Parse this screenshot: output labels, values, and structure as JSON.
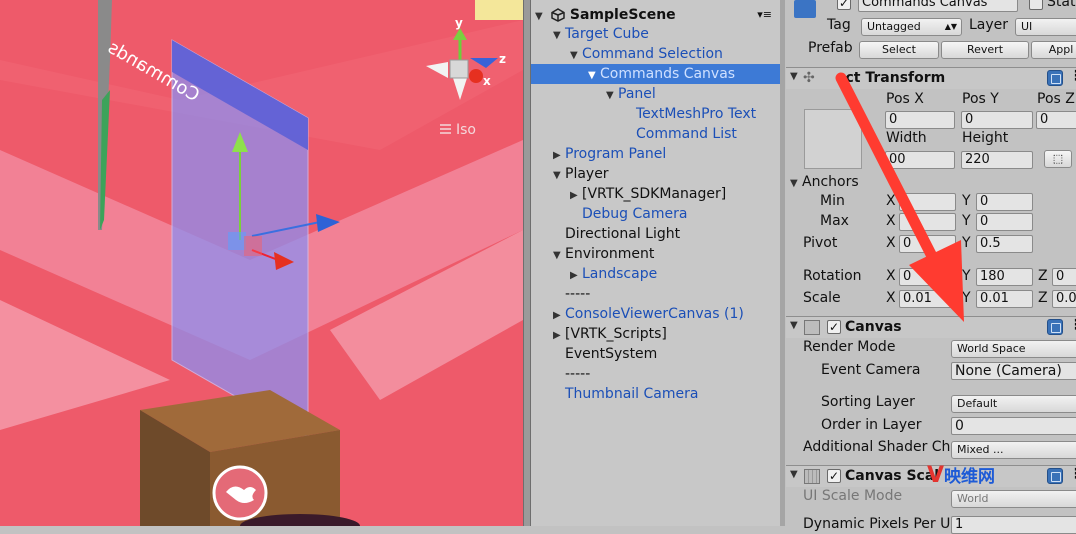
{
  "scene_view": {
    "canvas_text": "Commands",
    "gizmo_axes": {
      "x": "x",
      "y": "y",
      "z": "z"
    },
    "projection_label": "Iso"
  },
  "hierarchy": {
    "scene_name": "SampleScene",
    "items": [
      {
        "label": "Target Cube",
        "expanded": true,
        "selected": false
      },
      {
        "label": "Command Selection",
        "expanded": true,
        "selected": false
      },
      {
        "label": "Commands Canvas",
        "expanded": true,
        "selected": true
      },
      {
        "label": "Panel",
        "expanded": true,
        "selected": false
      },
      {
        "label": "TextMeshPro Text",
        "selected": false
      },
      {
        "label": "Command List",
        "selected": false
      },
      {
        "label": "Program Panel",
        "expanded": false,
        "selected": false
      },
      {
        "label": "Player",
        "expanded": true,
        "selected": false
      },
      {
        "label": "[VRTK_SDKManager]",
        "expanded": false,
        "selected": false
      },
      {
        "label": "Debug Camera",
        "selected": false
      },
      {
        "label": "Directional Light",
        "selected": false
      },
      {
        "label": "Environment",
        "expanded": true,
        "selected": false
      },
      {
        "label": "Landscape",
        "expanded": false,
        "selected": false
      },
      {
        "label": "-----",
        "selected": false
      },
      {
        "label": "ConsoleViewerCanvas (1)",
        "expanded": false,
        "selected": false
      },
      {
        "label": "[VRTK_Scripts]",
        "expanded": false,
        "selected": false
      },
      {
        "label": "EventSystem",
        "selected": false
      },
      {
        "label": "-----",
        "selected": false
      },
      {
        "label": "Thumbnail Camera",
        "selected": false
      }
    ]
  },
  "inspector": {
    "object_name": "Commands Canvas",
    "static_label": "Stat",
    "tag_label": "Tag",
    "tag_value": "Untagged",
    "layer_label": "Layer",
    "layer_value": "UI",
    "prefab_label": "Prefab",
    "prefab_select": "Select",
    "prefab_revert": "Revert",
    "prefab_apply": "Appl",
    "rect_transform": {
      "title": "ect Transform",
      "pos_x_label": "Pos X",
      "pos_y_label": "Pos Y",
      "pos_z_label": "Pos Z",
      "pos_x": "0",
      "pos_y": "0",
      "pos_z": "0",
      "width_label": "Width",
      "height_label": "Height",
      "width": "00",
      "height": "220",
      "anchors_label": "Anchors",
      "min_label": "Min",
      "max_label": "Max",
      "pivot_label": "Pivot",
      "x_label": "X",
      "y_label": "Y",
      "z_label": "Z",
      "min_x": "",
      "min_y": "0",
      "max_x": "",
      "max_y": "0",
      "pivot_x": "0",
      "pivot_y": "0.5",
      "rotation_label": "Rotation",
      "rot_x": "0",
      "rot_y": "180",
      "rot_z": "0",
      "scale_label": "Scale",
      "scale_x": "0.01",
      "scale_y": "0.01",
      "scale_z": "0.0"
    },
    "canvas": {
      "title": "Canvas",
      "render_mode_label": "Render Mode",
      "render_mode": "World Space",
      "event_camera_label": "Event Camera",
      "event_camera": "None (Camera)",
      "sorting_layer_label": "Sorting Layer",
      "sorting_layer": "Default",
      "order_label": "Order in Layer",
      "order": "0",
      "shader_label": "Additional Shader Ch",
      "shader_value": "Mixed ..."
    },
    "canvas_scaler": {
      "title": "Canvas Scal",
      "ui_scale_label": "UI Scale Mode",
      "ui_scale_value": "World",
      "dynamic_label": "Dynamic Pixels Per U",
      "dynamic_value": "1"
    }
  },
  "watermark": {
    "v": "V",
    "text": "映维网"
  },
  "colors": {
    "selection": "#3d7ad6",
    "annotation_arrow": "#ff3b30",
    "scene_bg": "#ee5a6a"
  }
}
